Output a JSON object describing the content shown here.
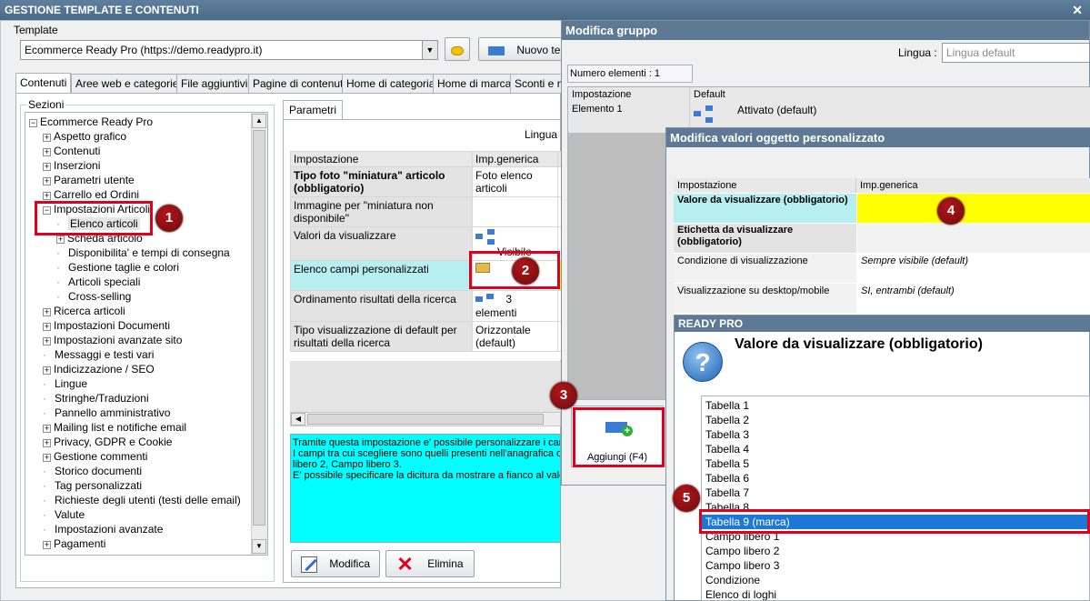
{
  "app": {
    "title": "GESTIONE TEMPLATE E CONTENUTI",
    "template_label": "Template",
    "template_value": "Ecommerce Ready Pro (https://demo.readypro.it)",
    "new_button": "Nuovo te",
    "tabs": [
      "Contenuti",
      "Aree web e categorie",
      "File aggiuntivi",
      "Pagine di contenuti",
      "Home di categoria",
      "Home di marca",
      "Sconti e ma"
    ],
    "sections_label": "Sezioni"
  },
  "tree": [
    {
      "label": "Ecommerce Ready Pro",
      "pm": "−"
    },
    {
      "label": "Aspetto grafico",
      "pm": "+"
    },
    {
      "label": "Contenuti",
      "pm": "+"
    },
    {
      "label": "Inserzioni",
      "pm": "+"
    },
    {
      "label": "Parametri utente",
      "pm": "+"
    },
    {
      "label": "Carrello ed Ordini",
      "pm": "+"
    },
    {
      "label": "Impostazioni Articoli",
      "pm": "−"
    },
    {
      "label": "Elenco articoli",
      "pm": ""
    },
    {
      "label": "Scheda articolo",
      "pm": "+"
    },
    {
      "label": "Disponibilita' e tempi di consegna",
      "pm": ""
    },
    {
      "label": "Gestione taglie e colori",
      "pm": ""
    },
    {
      "label": "Articoli speciali",
      "pm": ""
    },
    {
      "label": "Cross-selling",
      "pm": ""
    },
    {
      "label": "Ricerca articoli",
      "pm": "+"
    },
    {
      "label": "Impostazioni Documenti",
      "pm": "+"
    },
    {
      "label": "Impostazioni avanzate sito",
      "pm": "+"
    },
    {
      "label": "Messaggi e testi vari",
      "pm": ""
    },
    {
      "label": "Indicizzazione / SEO",
      "pm": "+"
    },
    {
      "label": "Lingue",
      "pm": ""
    },
    {
      "label": "Stringhe/Traduzioni",
      "pm": ""
    },
    {
      "label": "Pannello amministrativo",
      "pm": ""
    },
    {
      "label": "Mailing list e notifiche email",
      "pm": "+"
    },
    {
      "label": "Privacy, GDPR e Cookie",
      "pm": "+"
    },
    {
      "label": "Gestione commenti",
      "pm": "+"
    },
    {
      "label": "Storico documenti",
      "pm": ""
    },
    {
      "label": "Tag personalizzati",
      "pm": ""
    },
    {
      "label": "Richieste degli utenti (testi delle email)",
      "pm": ""
    },
    {
      "label": "Valute",
      "pm": ""
    },
    {
      "label": "Impostazioni avanzate",
      "pm": ""
    },
    {
      "label": "Pagamenti",
      "pm": "+"
    }
  ],
  "params": {
    "tab": "Parametri",
    "lingua_label": "Lingua :",
    "col_setting": "Impostazione",
    "col_generic": "Imp.generica",
    "rows": [
      {
        "name": "Tipo foto \"miniatura\" articolo (obbligatorio)",
        "value": "Foto elenco articoli"
      },
      {
        "name": "Immagine per \"miniatura non disponibile\"",
        "value": ""
      },
      {
        "name": "Valori da visualizzare",
        "value": "Visibile"
      },
      {
        "name": "Elenco campi personalizzati",
        "value": ""
      },
      {
        "name": "Ordinamento risultati della ricerca",
        "value": "3 elementi"
      },
      {
        "name": "Tipo visualizzazione di default per risultati della ricerca",
        "value": "Orizzontale (default)"
      }
    ],
    "description": [
      "Tramite questa impostazione e' possibile personalizzare i camp",
      "I campi tra cui scegliere sono quelli presenti nell'anagrafica del",
      "libero 2, Campo libero 3.",
      "E' possibile specificare la dicitura da mostrare a fianco al valore"
    ],
    "edit_button": "Modifica",
    "delete_button": "Elimina"
  },
  "group_window": {
    "title": "Modifica gruppo",
    "lingua_label": "Lingua :",
    "lingua_placeholder": "Lingua default",
    "count_label": "Numero elementi : 1",
    "col_setting": "Impostazione",
    "col_default": "Default",
    "row_name": "Elemento 1",
    "row_value": "Attivato (default)",
    "add_button": "Aggiungi (F4)"
  },
  "custom_window": {
    "title": "Modifica valori oggetto personalizzato",
    "col_setting": "Impostazione",
    "col_generic": "Imp.generica",
    "rows": [
      {
        "name": "Valore da visualizzare (obbligatorio)",
        "value": "",
        "style": "cyan-bold"
      },
      {
        "name": "Etichetta da visualizzare (obbligatorio)",
        "value": "",
        "style": "gray-bold"
      },
      {
        "name": "Condizione di visualizzazione",
        "value": "Sempre visibile (default)",
        "style": "plain"
      },
      {
        "name": "Visualizzazione su desktop/mobile",
        "value": "SI, entrambi (default)",
        "style": "plain"
      }
    ]
  },
  "readypro_dialog": {
    "title": "READY PRO",
    "question": "Valore da visualizzare (obbligatorio)",
    "options": [
      "Tabella 1",
      "Tabella 2",
      "Tabella 3",
      "Tabella 4",
      "Tabella 5",
      "Tabella 6",
      "Tabella 7",
      "Tabella 8",
      "Tabella 9 (marca)",
      "Campo libero 1",
      "Campo libero 2",
      "Campo libero 3",
      "Condizione",
      "Elenco di loghi"
    ],
    "selected": "Tabella 9 (marca)"
  },
  "badges": [
    "1",
    "2",
    "3",
    "4",
    "5"
  ],
  "colors": {
    "title_bar": "#5d7993",
    "highlight": "#b7eef0",
    "yellow": "#ffff00",
    "selection": "#1c77d7",
    "red": "#e0001e"
  }
}
